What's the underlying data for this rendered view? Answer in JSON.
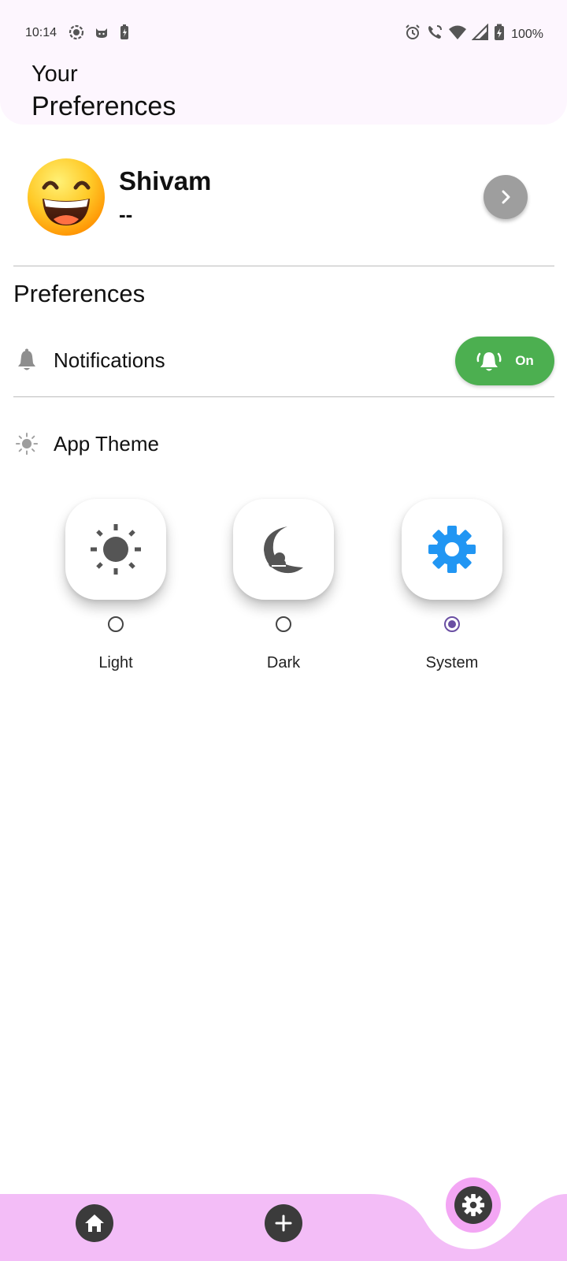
{
  "status_bar": {
    "time": "10:14",
    "battery": "100%",
    "left_icons": [
      "screen-record-icon",
      "cat-icon",
      "battery-saver-icon"
    ],
    "right_icons": [
      "alarm-icon",
      "wifi-calling-icon",
      "wifi-icon",
      "signal-icon",
      "battery-charging-icon"
    ]
  },
  "header": {
    "title_line1": "Your",
    "title_line2": "Preferences"
  },
  "profile": {
    "name": "Shivam",
    "subtitle": "--",
    "avatar_icon": "grinning-face-emoji",
    "action_icon": "chevron-right-icon"
  },
  "preferences": {
    "section_title": "Preferences",
    "notifications": {
      "label": "Notifications",
      "icon": "bell-icon",
      "toggle_label": "On",
      "toggle_icon": "bell-ringing-icon",
      "enabled": true,
      "toggle_color": "#4caf50"
    },
    "app_theme": {
      "label": "App Theme",
      "icon": "sun-outline-icon",
      "options": [
        {
          "label": "Light",
          "icon": "sun-icon",
          "selected": false
        },
        {
          "label": "Dark",
          "icon": "moon-cloud-icon",
          "selected": false
        },
        {
          "label": "System",
          "icon": "gear-icon",
          "selected": true
        }
      ],
      "selected": "System"
    }
  },
  "bottom_nav": {
    "items": [
      {
        "icon": "home-icon"
      },
      {
        "icon": "plus-icon"
      },
      {
        "icon": "gear-icon",
        "active": true
      }
    ],
    "bar_color": "#f3bdf7"
  },
  "colors": {
    "header_bg": "#fdf6fe",
    "radio_selected": "#6a4fa3",
    "system_gear": "#2196f3"
  }
}
